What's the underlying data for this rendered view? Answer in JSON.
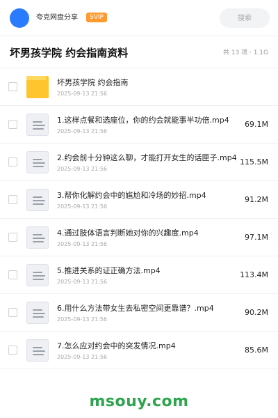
{
  "topbar": {
    "app_name": "夸克网盘分享",
    "badge": "SVIP",
    "search_placeholder": "搜索"
  },
  "folder": {
    "title": "坏男孩学院 约会指南资料",
    "meta": "共 13 项 · 1.1G"
  },
  "items": [
    {
      "type": "folder",
      "name": "坏男孩学院 约会指南",
      "date": "2025-09-13 21:56",
      "size": ""
    },
    {
      "type": "file",
      "name": "1.这样点餐和选座位，你的约会就能事半功倍.mp4",
      "date": "2025-09-13 21:56",
      "size": "69.1M"
    },
    {
      "type": "file",
      "name": "2.约会前十分钟这么聊，才能打开女生的话匣子.mp4",
      "date": "2025-09-13 21:56",
      "size": "115.5M"
    },
    {
      "type": "file",
      "name": "3.帮你化解约会中的尴尬和冷场的妙招.mp4",
      "date": "2025-09-13 21:56",
      "size": "91.2M"
    },
    {
      "type": "file",
      "name": "4.通过肢体语言判断她对你的兴趣度.mp4",
      "date": "2025-09-13 21:56",
      "size": "97.1M"
    },
    {
      "type": "file",
      "name": "5.推进关系的证正确方法.mp4",
      "date": "2025-09-13 21:56",
      "size": "113.4M"
    },
    {
      "type": "file",
      "name": "6.用什么方法带女生去私密空间更靠谱？.mp4",
      "date": "2025-09-13 21:56",
      "size": "90.2M"
    },
    {
      "type": "file",
      "name": "7.怎么应对约会中的突发情况.mp4",
      "date": "2025-09-13 21:56",
      "size": "85.6M"
    }
  ],
  "watermark": "msouy.com",
  "colors": {
    "accent": "#2b7bff",
    "badge": "#ff9a2e",
    "folder": "#ffc52e",
    "watermark": "#2ea44f"
  },
  "icons": {
    "folder": "folder-icon",
    "file": "file-icon"
  }
}
